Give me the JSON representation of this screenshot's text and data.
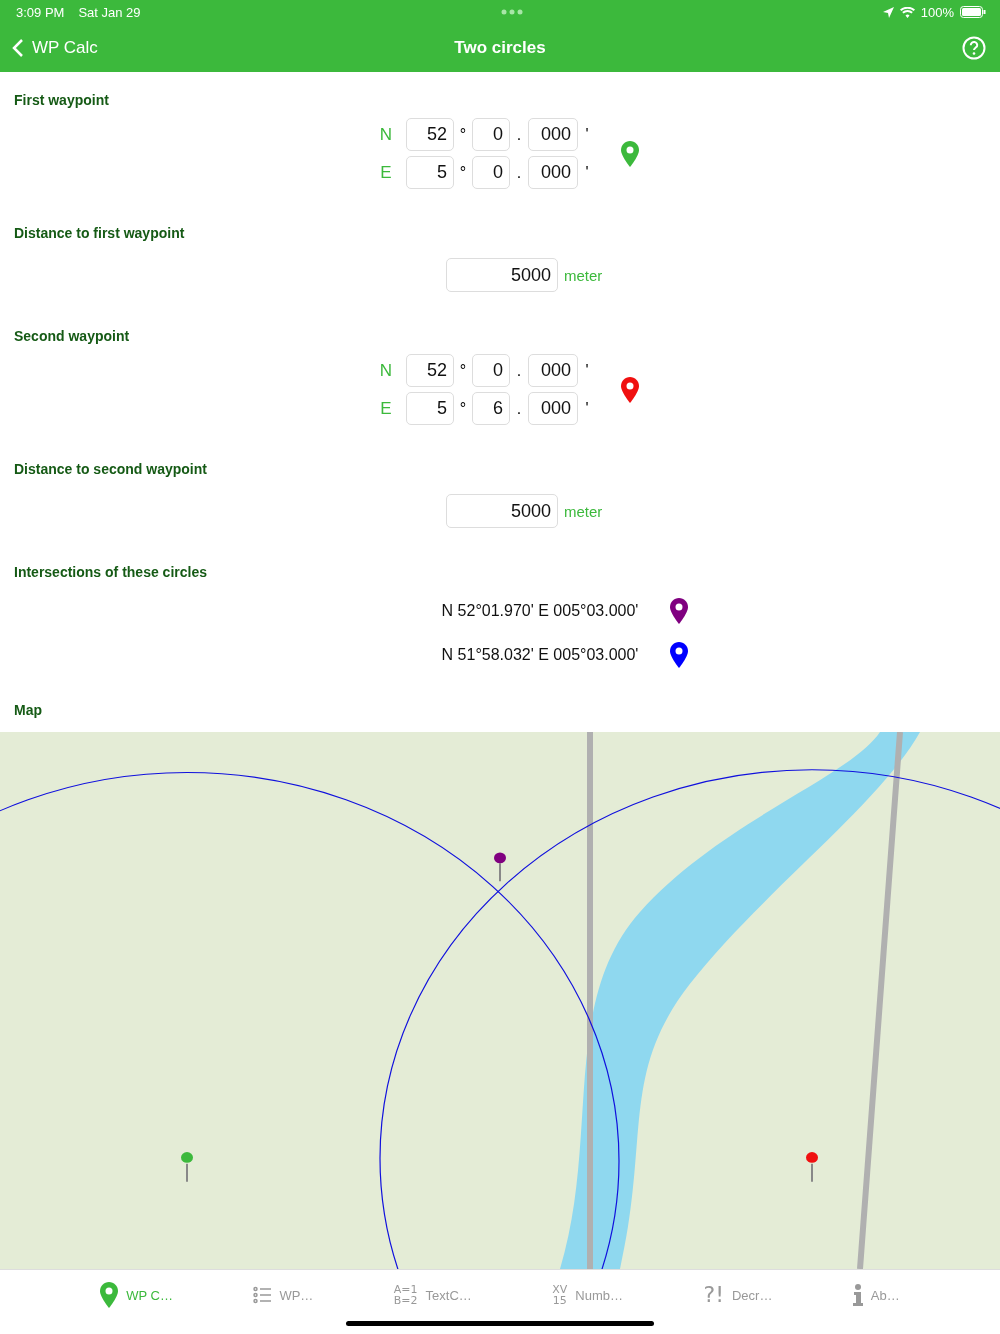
{
  "status_bar": {
    "time": "3:09 PM",
    "date": "Sat Jan 29",
    "battery": "100%"
  },
  "nav": {
    "back": "WP Calc",
    "title": "Two circles"
  },
  "sections": [
    {
      "kind": "waypoint",
      "label": "First waypoint",
      "color": "#3cb93c",
      "rows": [
        {
          "hemisphere": "N",
          "degrees": "52",
          "degree_mark": "°",
          "minutes": "0",
          "point": ".",
          "decimals": "000",
          "minute_mark": "'"
        },
        {
          "hemisphere": "E",
          "degrees": "5",
          "degree_mark": "°",
          "minutes": "0",
          "point": ".",
          "decimals": "000",
          "minute_mark": "'"
        }
      ]
    },
    {
      "kind": "distance",
      "label": "Distance to first waypoint",
      "value": "5000",
      "unit": "meter"
    },
    {
      "kind": "waypoint",
      "label": "Second waypoint",
      "color": "#f01010",
      "rows": [
        {
          "hemisphere": "N",
          "degrees": "52",
          "degree_mark": "°",
          "minutes": "0",
          "point": ".",
          "decimals": "000",
          "minute_mark": "'"
        },
        {
          "hemisphere": "E",
          "degrees": "5",
          "degree_mark": "°",
          "minutes": "6",
          "point": ".",
          "decimals": "000",
          "minute_mark": "'"
        }
      ]
    },
    {
      "kind": "distance",
      "label": "Distance to second waypoint",
      "value": "5000",
      "unit": "meter"
    },
    {
      "kind": "results",
      "label": "Intersections of these circles",
      "items": [
        {
          "text": "N 52°01.970' E 005°03.000'",
          "color": "#800080"
        },
        {
          "text": "N 51°58.032' E 005°03.000'",
          "color": "#0000ff"
        }
      ]
    },
    {
      "kind": "map",
      "label": "Map"
    }
  ],
  "tabs": [
    {
      "label": "WP C…",
      "kind": "pin",
      "selected": true
    },
    {
      "label": "WP…",
      "kind": "list",
      "selected": false
    },
    {
      "label": "TextC…",
      "kind": "glyph",
      "icon_lines": [
        "A=1",
        "B=2"
      ],
      "selected": false
    },
    {
      "label": "Numb…",
      "kind": "glyph",
      "icon_lines": [
        "XV",
        "15"
      ],
      "selected": false
    },
    {
      "label": "Decr…",
      "kind": "glyph",
      "icon_lines": [
        "?!"
      ],
      "selected": false
    },
    {
      "label": "Ab…",
      "kind": "info",
      "selected": false
    }
  ]
}
